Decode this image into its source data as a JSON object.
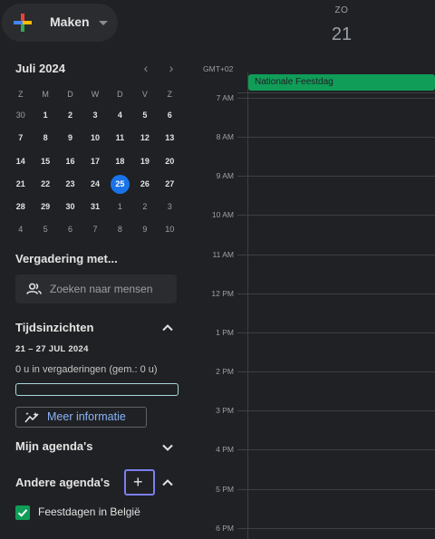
{
  "create": {
    "label": "Maken"
  },
  "mini_calendar": {
    "title": "Juli 2024",
    "days_of_week": [
      "Z",
      "M",
      "D",
      "W",
      "D",
      "V",
      "Z"
    ],
    "weeks": [
      [
        "30",
        "1",
        "2",
        "3",
        "4",
        "5",
        "6"
      ],
      [
        "7",
        "8",
        "9",
        "10",
        "11",
        "12",
        "13"
      ],
      [
        "14",
        "15",
        "16",
        "17",
        "18",
        "19",
        "20"
      ],
      [
        "21",
        "22",
        "23",
        "24",
        "25",
        "26",
        "27"
      ],
      [
        "28",
        "29",
        "30",
        "31",
        "1",
        "2",
        "3"
      ],
      [
        "4",
        "5",
        "6",
        "7",
        "8",
        "9",
        "10"
      ]
    ],
    "prev_arrow": "‹",
    "next_arrow": "›"
  },
  "meet": {
    "title": "Vergadering met...",
    "search_placeholder": "Zoeken naar mensen"
  },
  "insights": {
    "title": "Tijdsinzichten",
    "range": "21 – 27 JUL 2024",
    "hours": "0 u in vergaderingen (gem.: 0 u)",
    "more_label": "Meer informatie"
  },
  "my_calendars": {
    "title": "Mijn agenda's"
  },
  "other_calendars": {
    "title": "Andere agenda's",
    "add_label": "+",
    "items": [
      {
        "name": "Feestdagen in België",
        "checked": true,
        "color": "#0f9d58"
      }
    ]
  },
  "day_view": {
    "day_of_week": "ZO",
    "date": "21",
    "timezone": "GMT+02",
    "all_day_event": "Nationale Feestdag",
    "hours": [
      "7 AM",
      "8 AM",
      "9 AM",
      "10 AM",
      "11 AM",
      "12 PM",
      "1 PM",
      "2 PM",
      "3 PM",
      "4 PM",
      "5 PM",
      "6 PM"
    ]
  },
  "colors": {
    "background": "#202124",
    "accent": "#1a73e8",
    "event": "#0f9d58",
    "link": "#8ab4f8",
    "focus_outline": "#7b7ff0"
  }
}
